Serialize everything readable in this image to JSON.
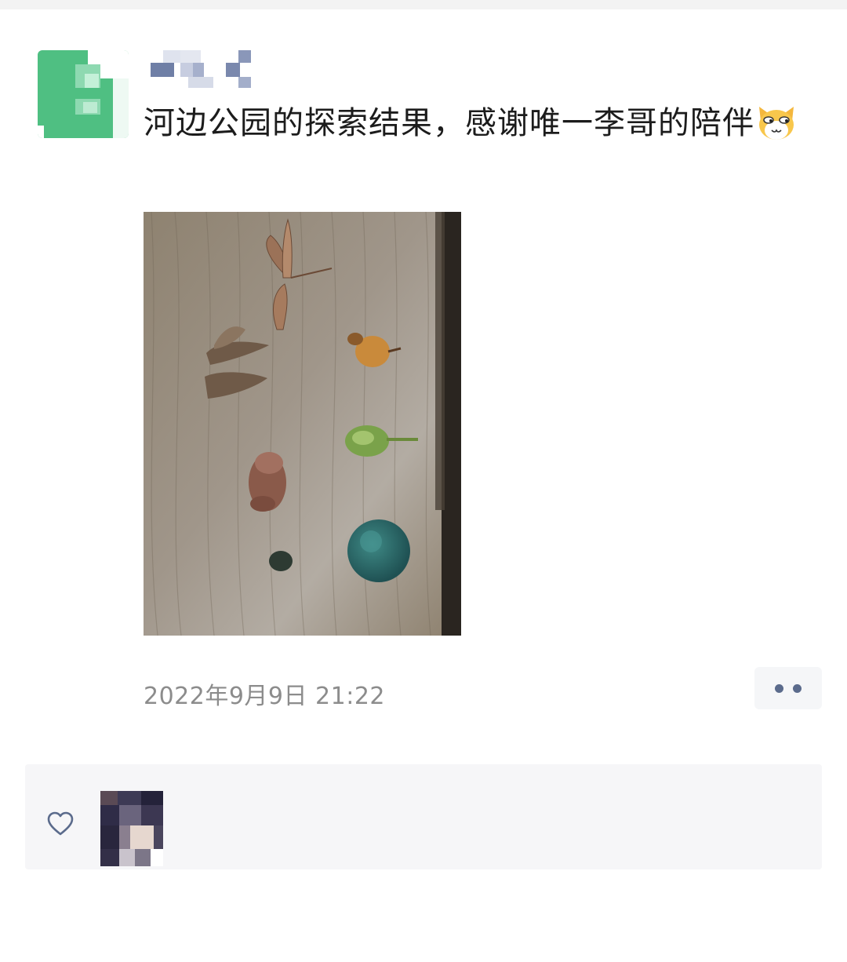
{
  "post": {
    "text": "河边公园的探索结果，感谢唯一李哥的陪伴",
    "emoji_icon": "smirk-cat-emoji-icon",
    "timestamp": "2022年9月9日 21:22"
  },
  "actions": {
    "more_icon": "more-dots-icon",
    "like_icon": "heart-outline-icon"
  },
  "colors": {
    "avatar_green": "#4fbf82",
    "timestamp_gray": "#8c8c8c",
    "link_blue": "#5b6b8c",
    "panel_bg": "#f6f6f8"
  }
}
